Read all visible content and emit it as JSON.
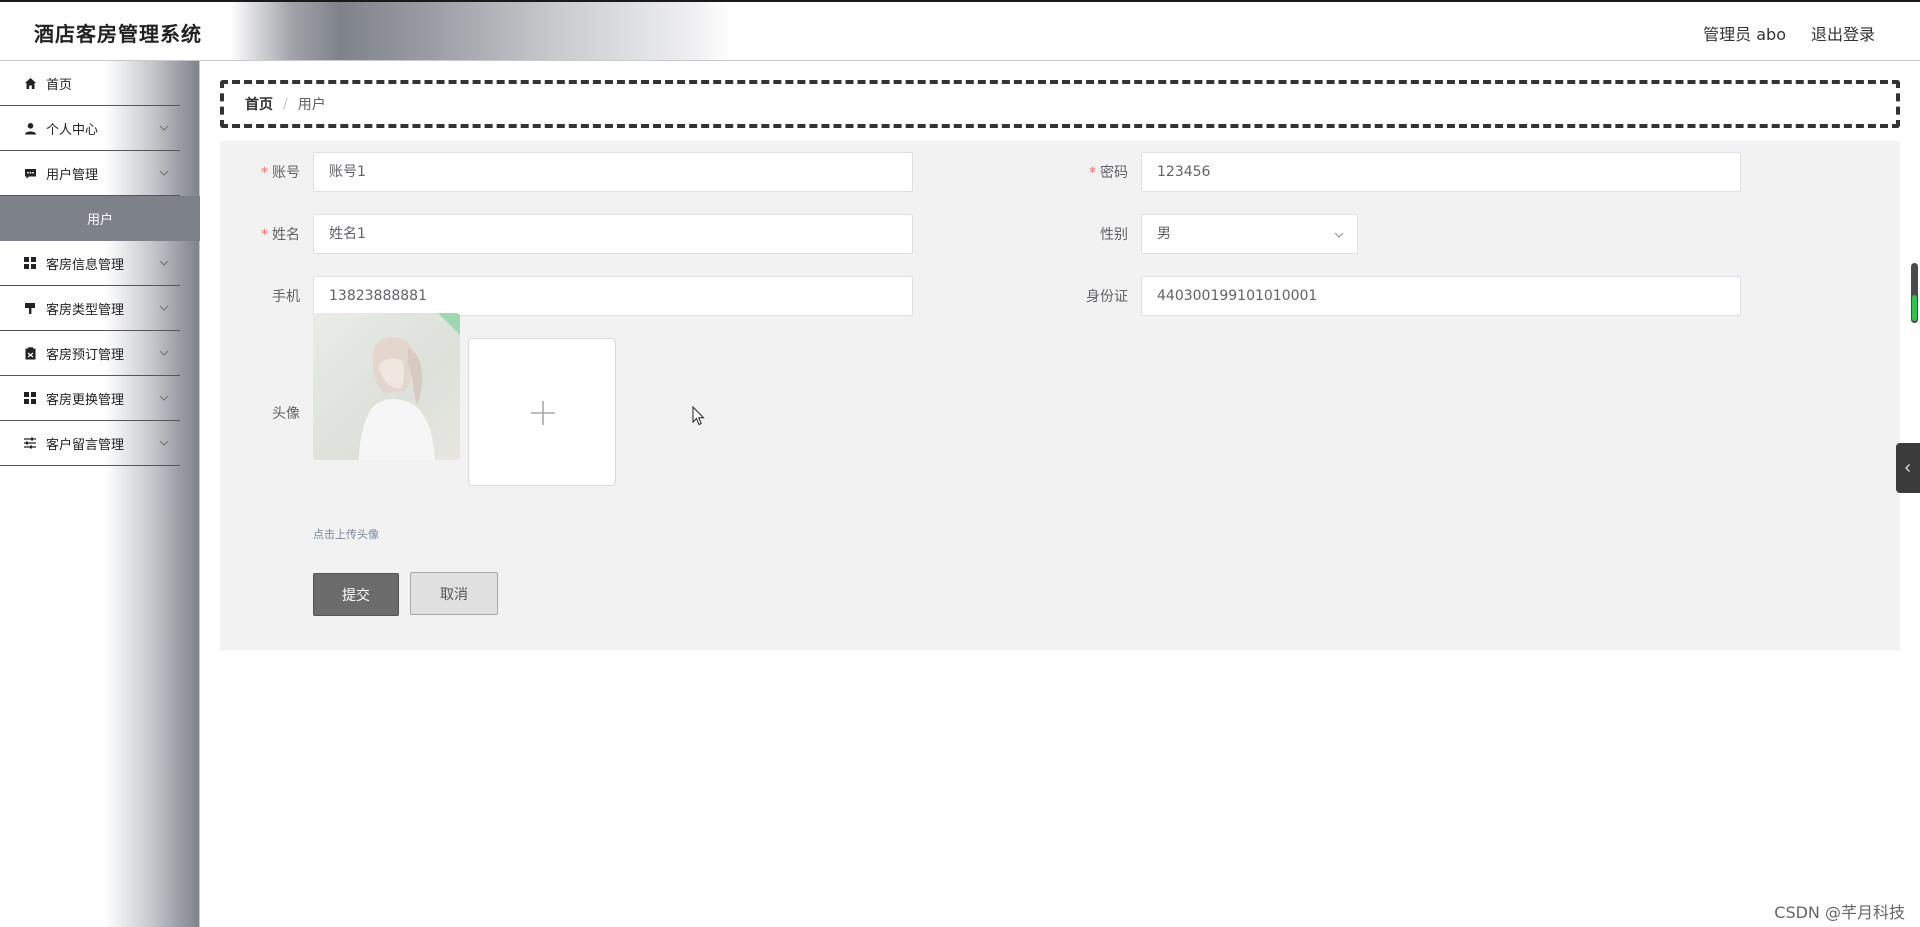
{
  "header": {
    "title": "酒店客房管理系统",
    "user": "管理员 abo",
    "logout": "退出登录"
  },
  "sidebar": {
    "items": [
      {
        "label": "首页",
        "icon": "home-icon"
      },
      {
        "label": "个人中心",
        "icon": "person-icon"
      },
      {
        "label": "用户管理",
        "icon": "chat-icon"
      },
      {
        "label": "用户",
        "icon": ""
      },
      {
        "label": "客房信息管理",
        "icon": "grid-icon"
      },
      {
        "label": "客房类型管理",
        "icon": "brush-icon"
      },
      {
        "label": "客房预订管理",
        "icon": "clipboard-icon"
      },
      {
        "label": "客房更换管理",
        "icon": "grid-icon"
      },
      {
        "label": "客户留言管理",
        "icon": "sliders-icon"
      }
    ]
  },
  "breadcrumb": {
    "home": "首页",
    "sep": "/",
    "current": "用户"
  },
  "form": {
    "account_label": "账号",
    "account_value": "账号1",
    "password_label": "密码",
    "password_value": "123456",
    "name_label": "姓名",
    "name_value": "姓名1",
    "gender_label": "性别",
    "gender_value": "男",
    "phone_label": "手机",
    "phone_value": "13823888881",
    "idcard_label": "身份证",
    "idcard_value": "440300199101010001",
    "avatar_label": "头像",
    "upload_hint": "点击上传头像",
    "required_mark": "*",
    "submit": "提交",
    "cancel": "取消"
  },
  "watermark": "CSDN @芊月科技",
  "colors": {
    "accent_gray": "#7d8189",
    "required_red": "#f56c6c",
    "panel_bg": "#f2f2f2",
    "scroll_green": "#32c24e"
  }
}
